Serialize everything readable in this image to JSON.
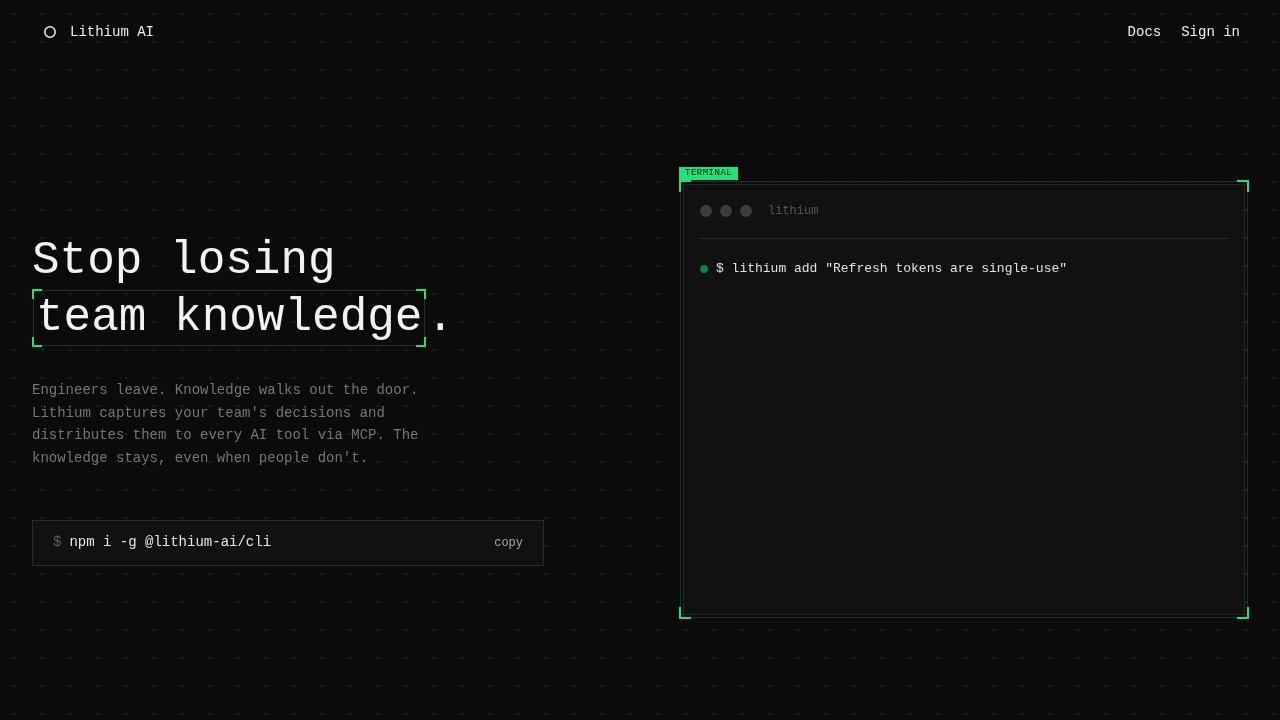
{
  "nav": {
    "brand": "Lithium AI",
    "links": [
      "Docs",
      "Sign in"
    ]
  },
  "hero": {
    "title_lines": [
      {
        "text": "Stop losing",
        "highlighted": false
      },
      {
        "text": "team knowledge",
        "highlighted": true
      }
    ],
    "title_suffix": ".",
    "description": "Engineers leave. Knowledge walks out the door. Lithium captures your team's decisions and distributes them to every AI tool via MCP. The knowledge stays, even when people don't.",
    "install": {
      "prompt": "$",
      "command": "npm i -g @lithium-ai/cli",
      "copy_label": "copy"
    }
  },
  "terminal": {
    "tag": "TERMINAL",
    "title": "lithium",
    "lines": [
      "$ lithium add \"Refresh tokens are single-use\""
    ]
  }
}
